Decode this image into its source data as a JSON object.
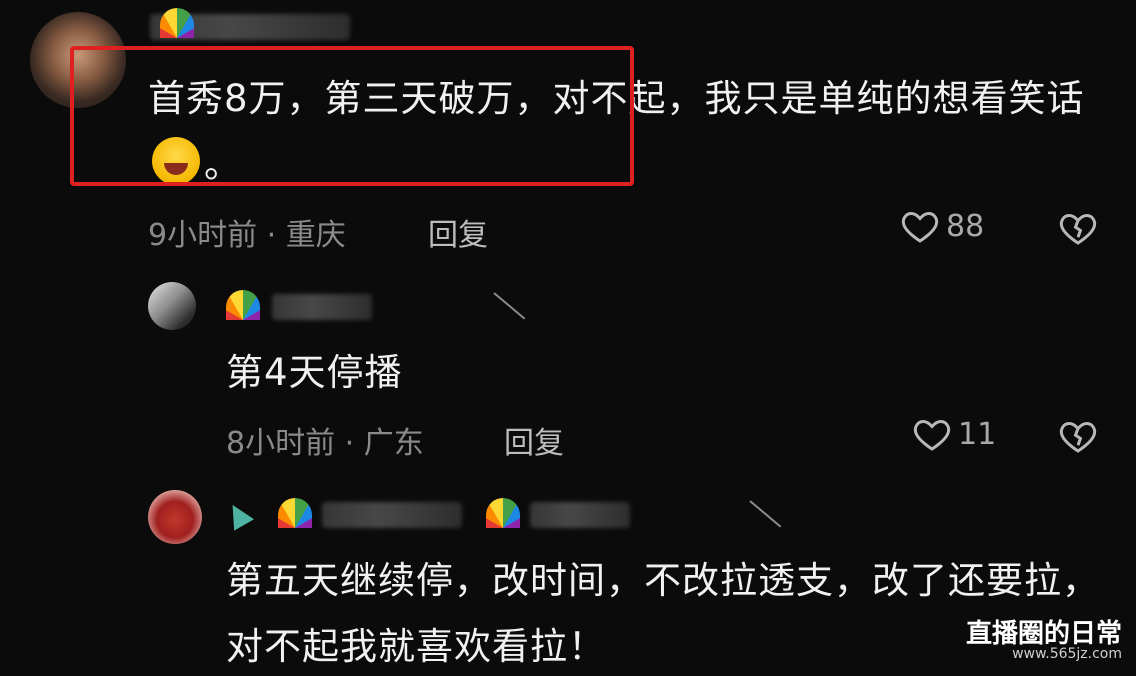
{
  "comments": [
    {
      "text_before_emoji": "首秀8万，第三天破万，对不起，我只是单纯的想看笑话",
      "text_after_emoji": "。",
      "emoji": "laughing-with-tears",
      "time_location": "9小时前 · 重庆",
      "reply_label": "回复",
      "likes": "88"
    },
    {
      "text": "第4天停播",
      "time_location": "8小时前 · 广东",
      "reply_label": "回复",
      "likes": "11"
    },
    {
      "text": "第五天继续停，改时间，不改拉透支，改了还要拉，对不起我就喜欢看拉！"
    }
  ],
  "watermark": {
    "title": "直播圈的日常",
    "url": "www.565jz.com"
  },
  "colors": {
    "background": "#0b0b0b",
    "highlight": "#e02020",
    "meta": "#8a8a8a"
  }
}
